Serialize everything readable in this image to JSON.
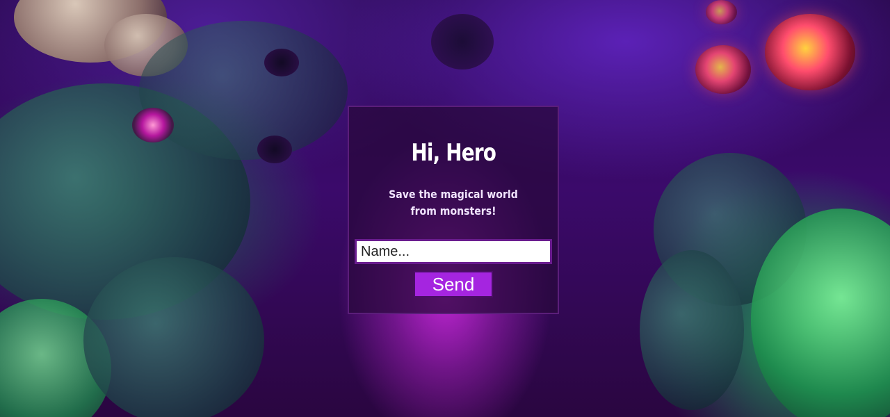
{
  "background": {
    "description_icon": "fantasy-monster-forest-background",
    "accent_purple": "#a525e0",
    "card_border": "#5b1e7a"
  },
  "card": {
    "title": "Hi, Hero",
    "subtitle": "Save the magical world from monsters!",
    "name_input": {
      "value": "",
      "placeholder": "Name..."
    },
    "send_label": "Send"
  }
}
